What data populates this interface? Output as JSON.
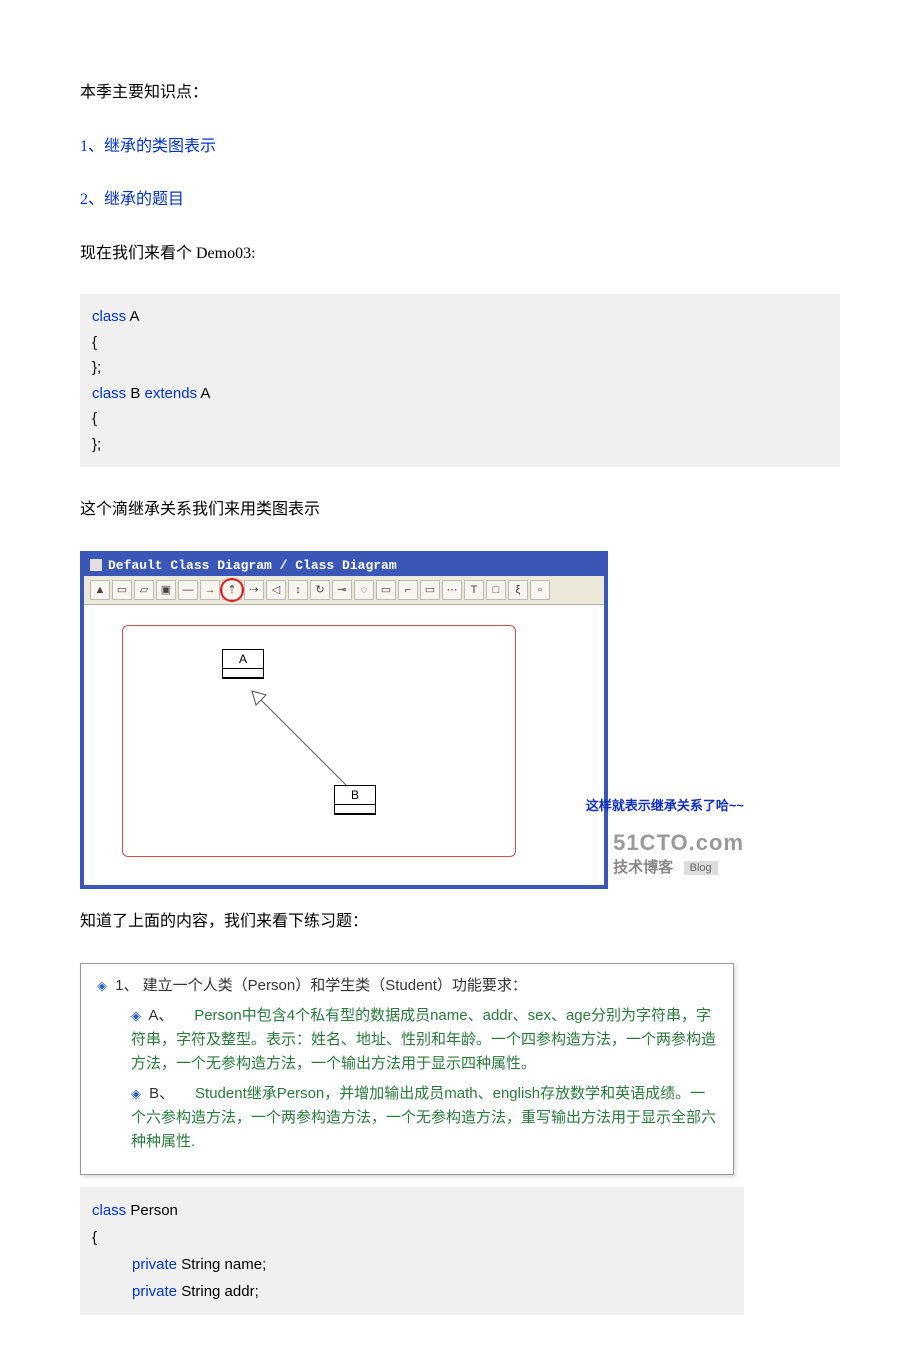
{
  "intro": {
    "heading": "本季主要知识点：",
    "point1": "1、继承的类图表示",
    "point2": "2、继承的题目",
    "demo_line": "现在我们来看个 Demo03:"
  },
  "code1": {
    "l1a": "class",
    "l1b": " A",
    "l2": "{",
    "l3": "};",
    "l4a": "class",
    "l4b": " B ",
    "l4c": "extends",
    "l4d": " A",
    "l5": "{",
    "l6": "};"
  },
  "after_code1": "这个滴继承关系我们来用类图表示",
  "diagram": {
    "title": "Default Class Diagram / Class Diagram",
    "boxA": "A",
    "boxB": "B",
    "note": "这样就表示继承关系了哈~~",
    "wm_top": "51CTO.com",
    "wm_bot": "技术博客",
    "wm_chip": "Blog",
    "tool_T": "T",
    "tool_dots": "⋯",
    "tool_s": "ξ"
  },
  "after_diag": "知道了上面的内容，我们来看下练习题：",
  "exercise": {
    "main": "1、 建立一个人类（Person）和学生类（Student）功能要求：",
    "a_lead": "A、",
    "a_body": "Person中包含4个私有型的数据成员name、addr、sex、age分别为字符串，字符串，字符及整型。表示：姓名、地址、性别和年龄。一个四参构造方法，一个两参构造方法，一个无参构造方法，一个输出方法用于显示四种属性。",
    "b_lead": "B、",
    "b_body": "Student继承Person，并增加输出成员math、english存放数学和英语成绩。一个六参构造方法，一个两参构造方法，一个无参构造方法，重写输出方法用于显示全部六种种属性."
  },
  "code2": {
    "l1a": "class",
    "l1b": " Person",
    "l2": "{",
    "l3a": "private",
    "l3b": " String name;",
    "l4a": "private",
    "l4b": " String addr;"
  }
}
